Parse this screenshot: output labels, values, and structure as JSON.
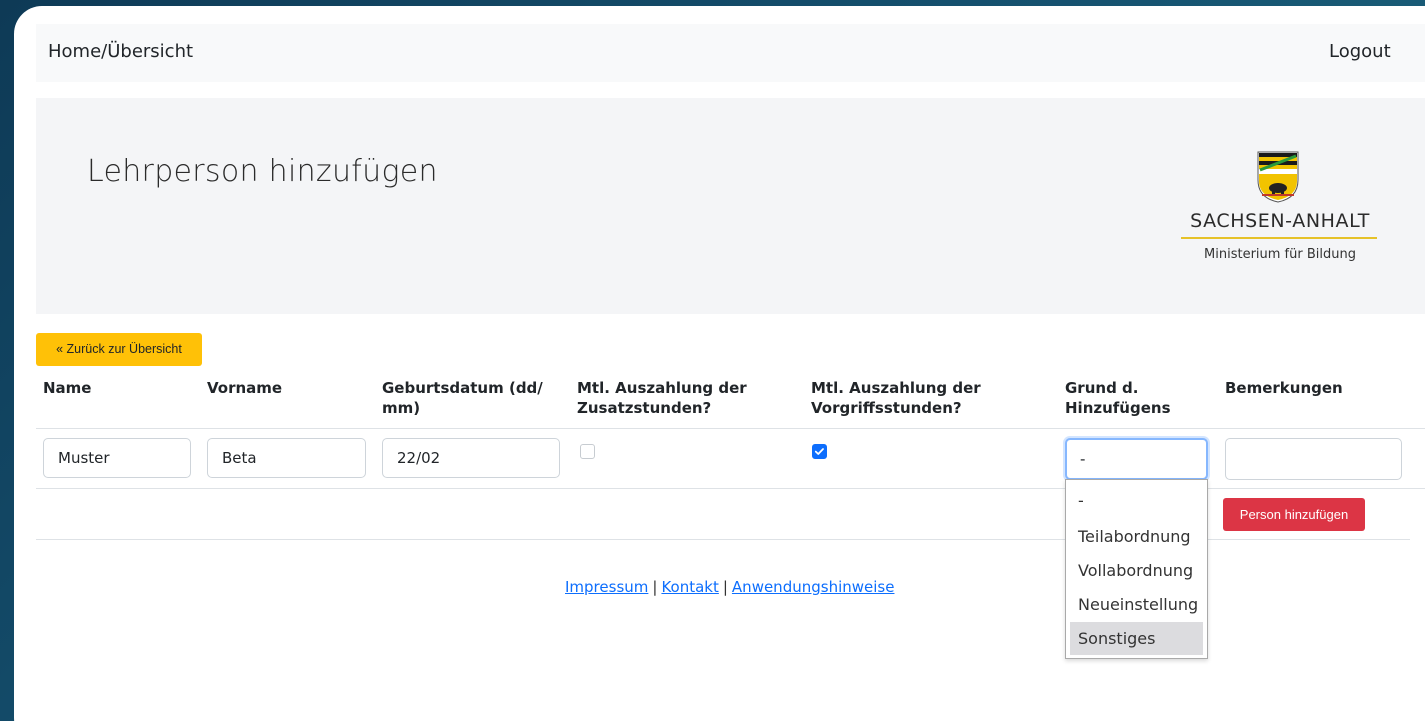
{
  "nav": {
    "home": "Home/Übersicht",
    "logout": "Logout"
  },
  "header": {
    "title": "Lehrperson hinzufügen",
    "logo_name": "SACHSEN-ANHALT",
    "logo_sub": "Ministerium für Bildung"
  },
  "back_button": "« Zurück zur Übersicht",
  "table": {
    "headers": [
      "Name",
      "Vorname",
      "Geburtsdatum (dd/ mm)",
      "Mtl. Auszahlung der Zusatzstunden?",
      "Mtl. Auszahlung der Vorgriffsstunden?",
      "Grund d. Hinzufügens",
      "Bemerkungen"
    ],
    "row": {
      "name": "Muster",
      "vorname": "Beta",
      "geburtsdatum": "22/02",
      "zusatzstunden_checked": false,
      "vorgriffsstunden_checked": true,
      "grund_selected": "-",
      "bemerkungen": ""
    }
  },
  "grund_options": [
    "-",
    "Teilabordnung",
    "Vollabordnung",
    "Neueinstellung",
    "Sonstiges"
  ],
  "highlighted_option": "Sonstiges",
  "add_button": "Person hinzufügen",
  "footer": {
    "impressum": "Impressum",
    "kontakt": "Kontakt",
    "hinweise": "Anwendungshinweise",
    "separator": "|"
  },
  "colors": {
    "back_button": "#ffc107",
    "add_button": "#dc3545",
    "link": "#0d6efd",
    "checkbox_on": "#0d6efd"
  }
}
